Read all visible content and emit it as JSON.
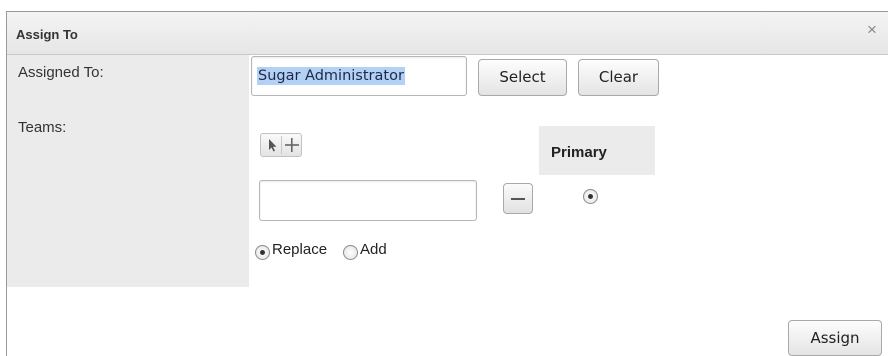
{
  "dialog": {
    "title": "Assign To",
    "close_label": "×"
  },
  "form": {
    "assigned_to_label": "Assigned To:",
    "assigned_to_value": "Sugar Administrator",
    "select_label": "Select",
    "clear_label": "Clear",
    "teams_label": "Teams:",
    "primary_header": "Primary",
    "team_input_value": "",
    "replace_label": "Replace",
    "add_label": "Add",
    "selected_mode": "Replace",
    "primary_selected": true
  },
  "footer": {
    "assign_label": "Assign"
  },
  "icons": {
    "select_arrow": "cursor-arrow-icon",
    "add": "plus-icon",
    "remove": "minus-icon",
    "close": "close-icon"
  }
}
